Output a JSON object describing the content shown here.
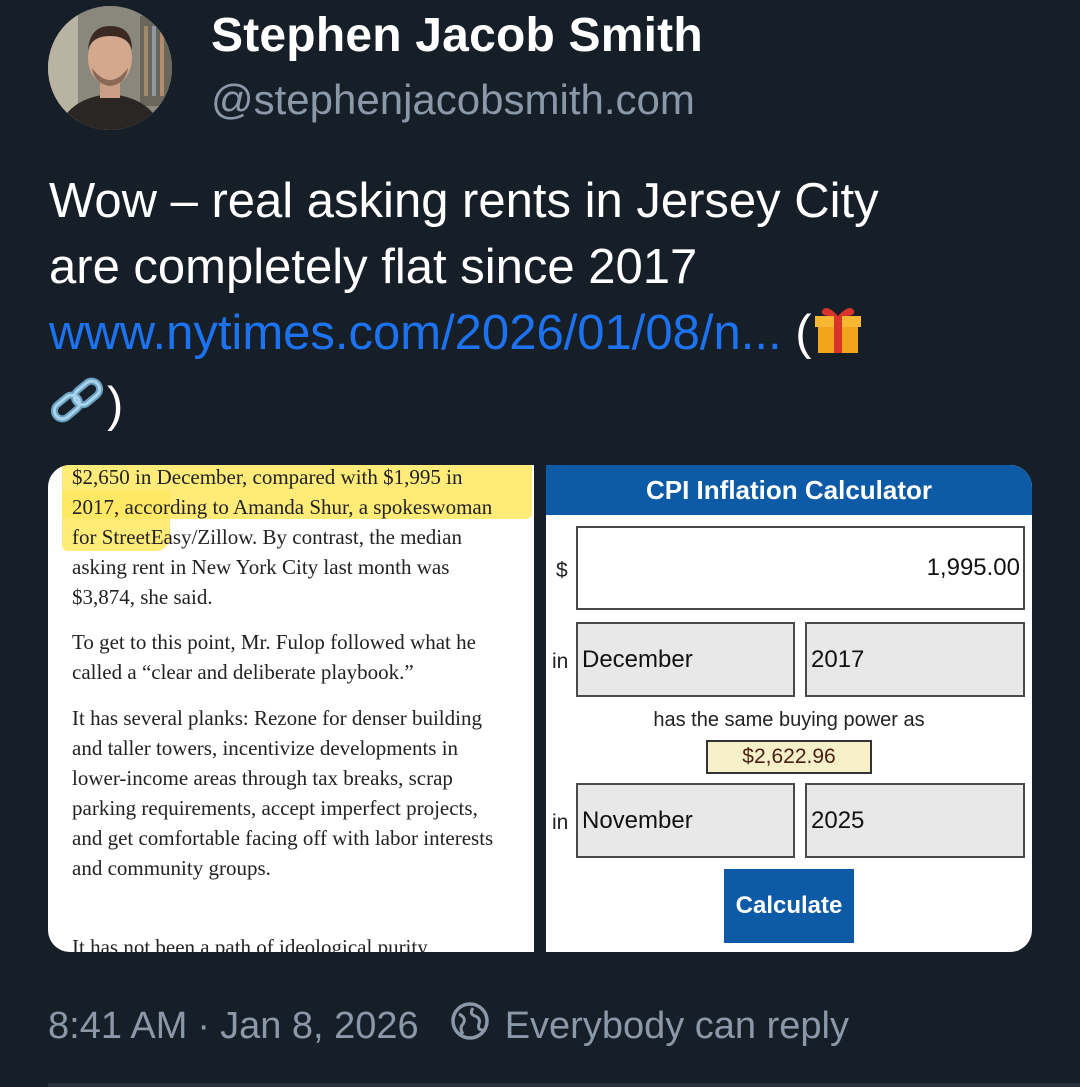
{
  "author": {
    "name": "Stephen Jacob Smith",
    "handle": "@stephenjacobsmith.com",
    "avatar_icon": "profile-photo"
  },
  "post": {
    "text_line1": "Wow – real asking rents in Jersey City",
    "text_line2": "are completely flat since 2017",
    "link": "www.nytimes.com/2026/01/08/n...",
    "link_suffix_open": "(",
    "gift_icon": "gift-icon",
    "link_icon": "link-icon",
    "link_suffix_close": ")"
  },
  "article": {
    "p1": "$2,650 in December, compared with $1,995 in 2017, according to Amanda Shur, a spokeswoman for StreetEasy/Zillow. By contrast, the median asking rent in New York City last month was $3,874, she said.",
    "p2": "To get to this point, Mr. Fulop followed what he called a “clear and deliberate playbook.”",
    "p3": "It has several planks: Rezone for denser building and taller towers, incentivize developments in lower-income areas through tax breaks, scrap parking requirements, accept imperfect projects, and get comfortable facing off with labor interests and community groups.",
    "p4": "It has not been a path of ideological purity"
  },
  "calculator": {
    "title": "CPI Inflation Calculator",
    "currency": "$",
    "amount": "1,995.00",
    "in_label": "in",
    "from_month": "December",
    "from_year": "2017",
    "same_power": "has the same buying power as",
    "result": "$2,622.96",
    "to_month": "November",
    "to_year": "2025",
    "button": "Calculate",
    "colors": {
      "header": "#0d5ba6",
      "result_bg": "#f6f0c8"
    }
  },
  "meta": {
    "time": "8:41 AM",
    "separator": "·",
    "date": "Jan 8, 2026",
    "reply_icon": "reply-settings-icon",
    "reply_setting": "Everybody can reply"
  },
  "colors": {
    "background": "#161e28",
    "link": "#1d72ef",
    "secondary_text": "#8b98a8"
  }
}
